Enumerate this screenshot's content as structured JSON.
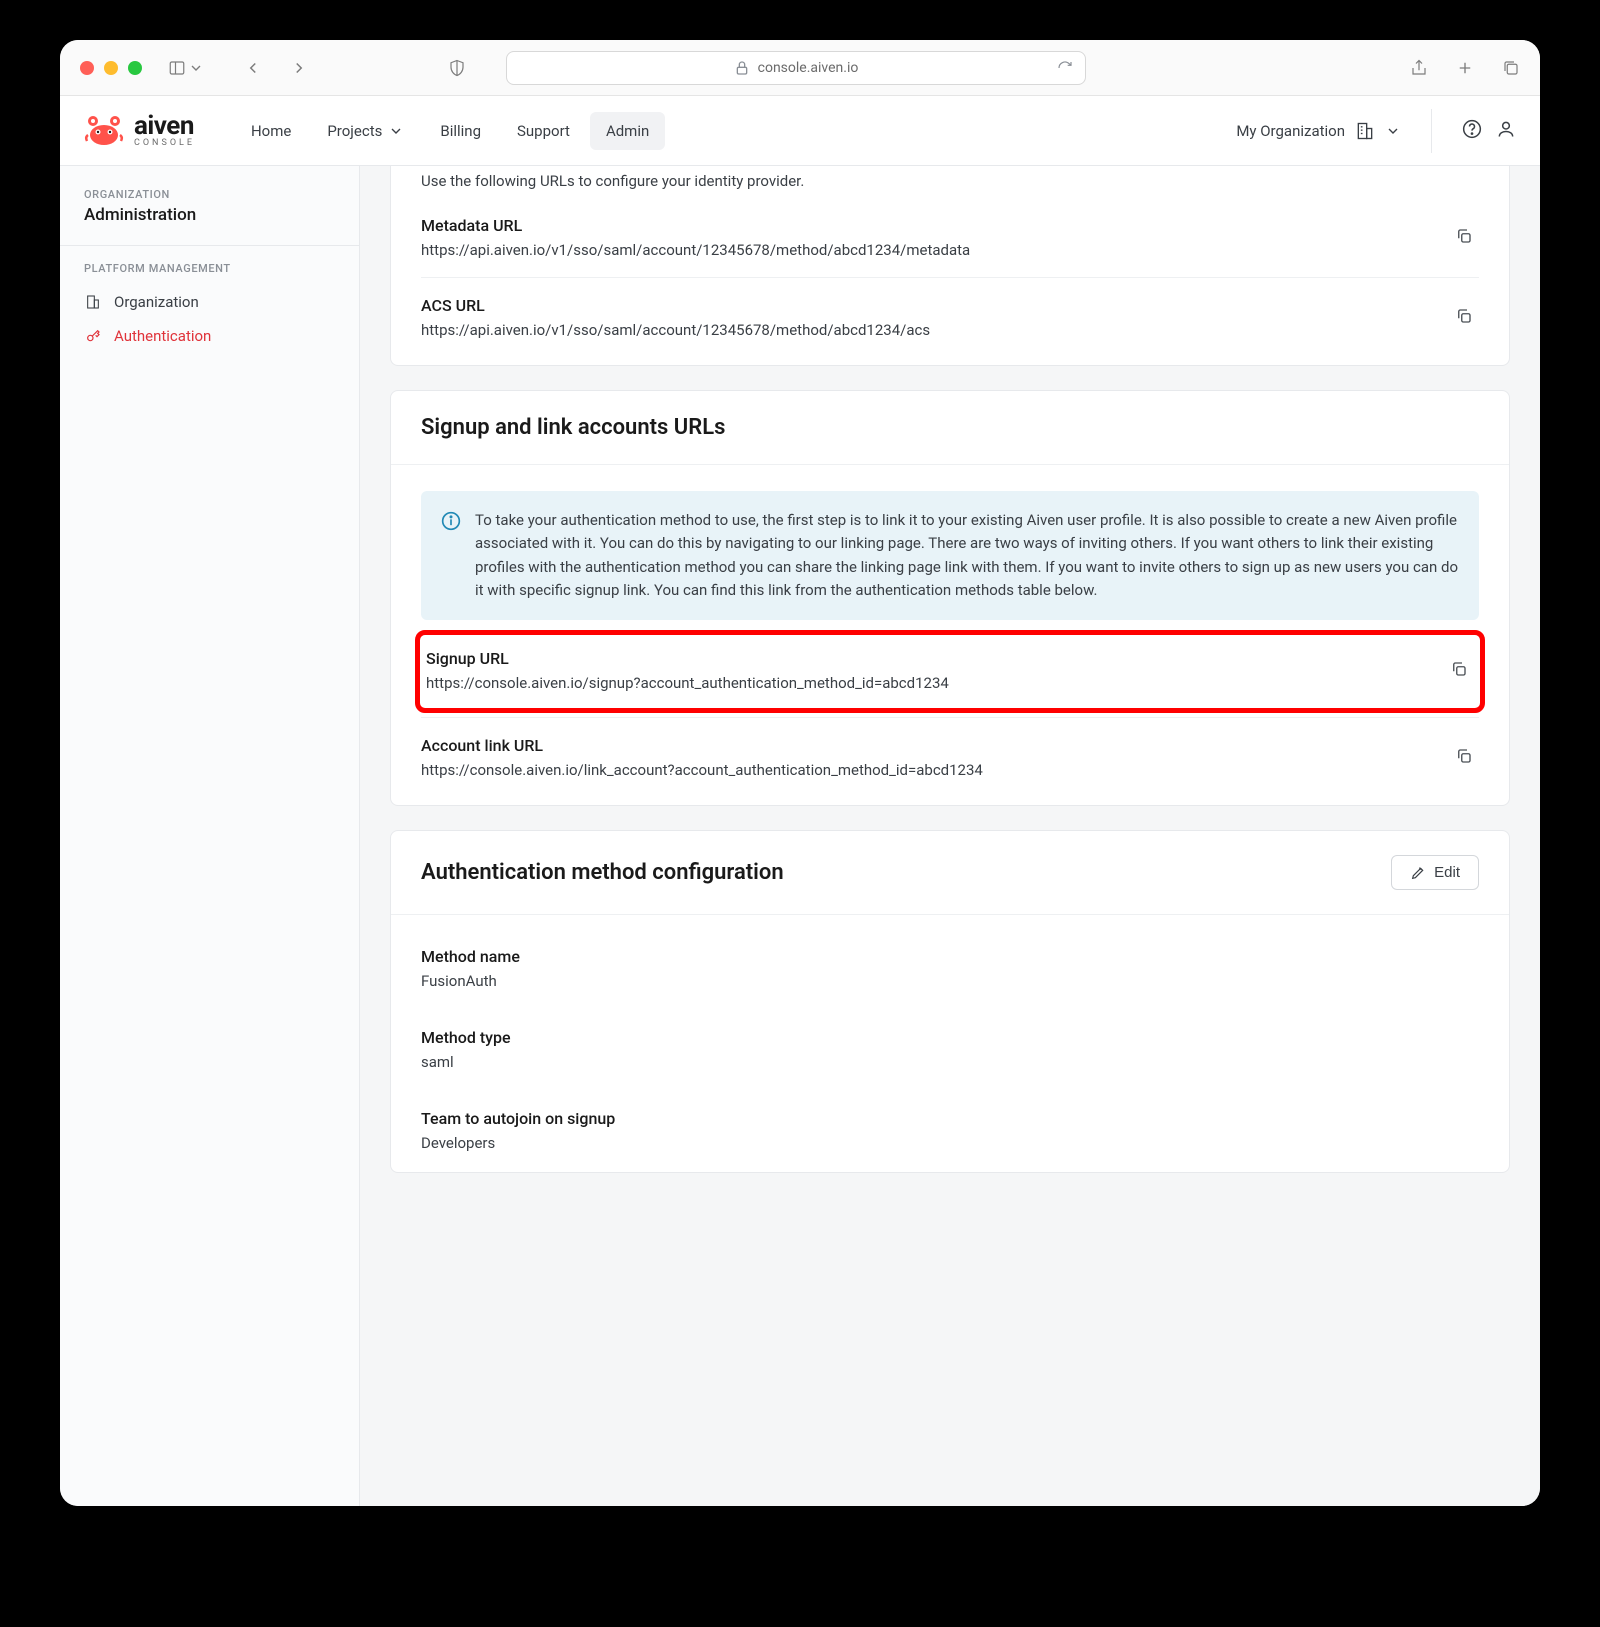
{
  "browser": {
    "url_display": "console.aiven.io"
  },
  "header": {
    "brand": "aiven",
    "brand_sub": "CONSOLE",
    "nav": {
      "home": "Home",
      "projects": "Projects",
      "billing": "Billing",
      "support": "Support",
      "admin": "Admin"
    },
    "org_label": "My Organization"
  },
  "sidebar": {
    "org_label": "ORGANIZATION",
    "org_name": "Administration",
    "platform_label": "PLATFORM MANAGEMENT",
    "items": {
      "organization": "Organization",
      "authentication": "Authentication"
    }
  },
  "idp": {
    "intro": "Use the following URLs to configure your identity provider.",
    "metadata_label": "Metadata URL",
    "metadata_value": "https://api.aiven.io/v1/sso/saml/account/12345678/method/abcd1234/metadata",
    "acs_label": "ACS URL",
    "acs_value": "https://api.aiven.io/v1/sso/saml/account/12345678/method/abcd1234/acs"
  },
  "signup": {
    "heading": "Signup and link accounts URLs",
    "info_text": "To take your authentication method to use, the first step is to link it to your existing Aiven user profile. It is also possible to create a new Aiven profile associated with it. You can do this by navigating to our linking page. There are two ways of inviting others. If you want others to link their existing profiles with the authentication method you can share the linking page link with them. If you want to invite others to sign up as new users you can do it with specific signup link. You can find this link from the authentication methods table below.",
    "signup_label": "Signup URL",
    "signup_value": "https://console.aiven.io/signup?account_authentication_method_id=abcd1234",
    "link_label": "Account link URL",
    "link_value": "https://console.aiven.io/link_account?account_authentication_method_id=abcd1234"
  },
  "config": {
    "heading": "Authentication method configuration",
    "edit_label": "Edit",
    "name_label": "Method name",
    "name_value": "FusionAuth",
    "type_label": "Method type",
    "type_value": "saml",
    "team_label": "Team to autojoin on signup",
    "team_value": "Developers"
  }
}
